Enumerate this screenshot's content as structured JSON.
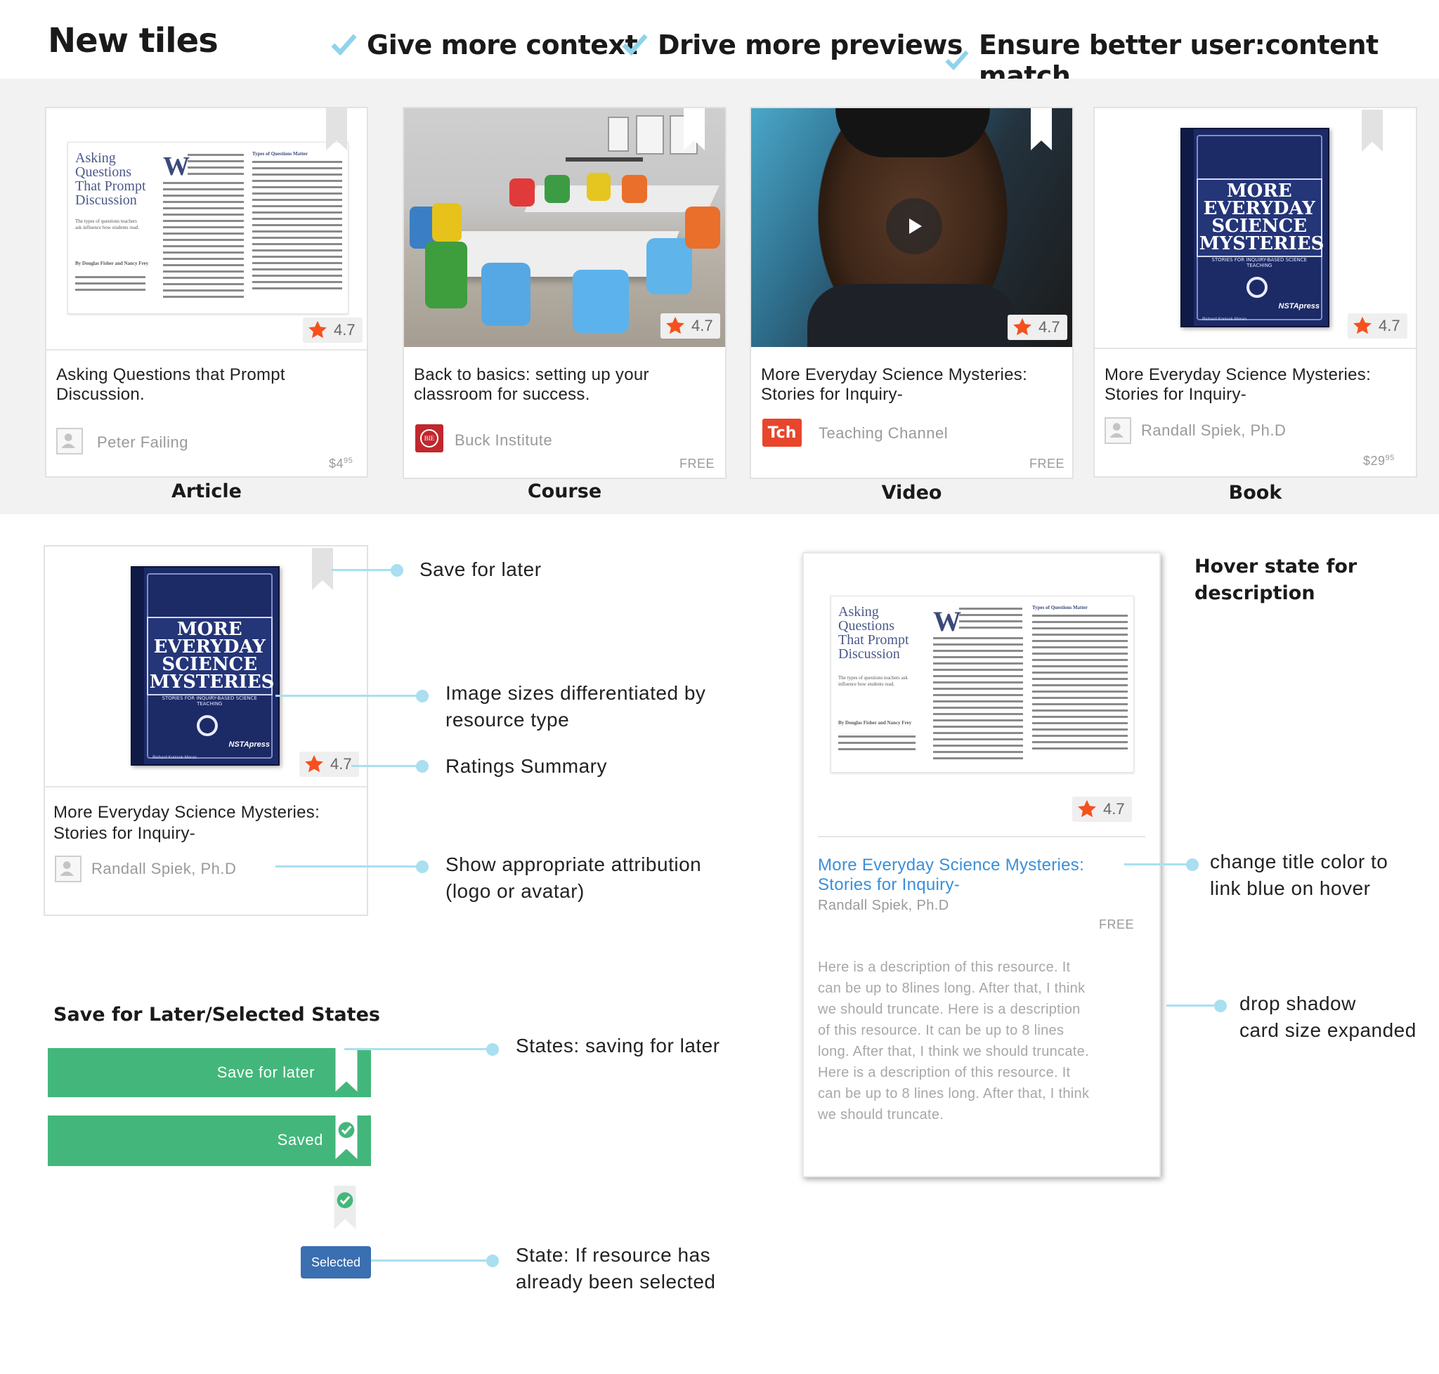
{
  "header": {
    "title": "New tiles",
    "points": [
      "Give more context",
      "Drive more previews",
      "Ensure better user:content match"
    ]
  },
  "article_thumb": {
    "heading": [
      "Asking",
      "Questions",
      "That Prompt",
      "Discussion"
    ],
    "intro": "The types of questions teachers ask influence how students read.",
    "byline": "By Douglas Fisher and Nancy Frey",
    "col_head": "Types of Questions Matter"
  },
  "book_cover": {
    "line1": "MORE",
    "line2": "EVERYDAY",
    "line3": "SCIENCE",
    "line4": "MYSTERIES",
    "sub": "STORIES FOR INQUIRY-BASED SCIENCE TEACHING",
    "publisher": "NSTApress",
    "author": "Richard Konicek-Moran"
  },
  "tiles": [
    {
      "type": "Article",
      "title": "Asking Questions that Prompt Discussion.",
      "author": "Peter Failing",
      "price": "$4",
      "price_cents": "95",
      "rating": "4.7"
    },
    {
      "type": "Course",
      "title": "Back to basics: setting up your classroom for success.",
      "author": "Buck Institute",
      "price": "FREE",
      "rating": "4.7",
      "logo": "BIE"
    },
    {
      "type": "Video",
      "title": "More Everyday Science Mysteries: Stories for Inquiry-",
      "author": "Teaching Channel",
      "price": "FREE",
      "rating": "4.7",
      "logo": "Tch"
    },
    {
      "type": "Book",
      "title": "More Everyday Science Mysteries: Stories for Inquiry-",
      "author": "Randall Spiek, Ph.D",
      "price": "$29",
      "price_cents": "95",
      "rating": "4.7"
    }
  ],
  "detail_card": {
    "title": "More Everyday Science Mysteries: Stories for Inquiry-",
    "author": "Randall Spiek, Ph.D",
    "rating": "4.7"
  },
  "annotations": {
    "save_for_later": "Save for later",
    "image_sizes": [
      "Image sizes differentiated by",
      "resource type"
    ],
    "ratings_summary": "Ratings Summary",
    "attribution": [
      "Show appropriate attribution",
      "(logo or avatar)"
    ],
    "hover_header": [
      "Hover state for",
      "description"
    ],
    "title_color": [
      "change title color to",
      "link blue on hover"
    ],
    "drop_shadow": [
      "drop shadow",
      "card size expanded"
    ],
    "states_saving": "States: saving for later",
    "state_selected": [
      "State: If resource has",
      "already been selected"
    ]
  },
  "states": {
    "header": "Save for Later/Selected States",
    "save_label": "Save for later",
    "saved_label": "Saved",
    "selected_label": "Selected"
  },
  "hover_card": {
    "title": "More Everyday Science Mysteries: Stories for Inquiry-",
    "author": "Randall Spiek, Ph.D",
    "price": "FREE",
    "rating": "4.7",
    "description": [
      "Here is a description of this resource. It",
      "can be up to 8lines long. After that, I think",
      "we should truncate. Here is a description",
      "of this resource. It can be up to 8 lines",
      "long. After that, I think we should truncate.",
      "Here is a description of this resource. It",
      "can be up to 8 lines long. After that, I think",
      "we should truncate."
    ]
  },
  "colors": {
    "accent_check": "#8fd3ec",
    "annotation_line": "#a9dff0",
    "green": "#43b77b",
    "selected_blue": "#3a6fb1",
    "link_blue": "#3b8fd9",
    "star": "#f4511e",
    "tch_red": "#e8452c",
    "bie_red": "#c0282d"
  }
}
